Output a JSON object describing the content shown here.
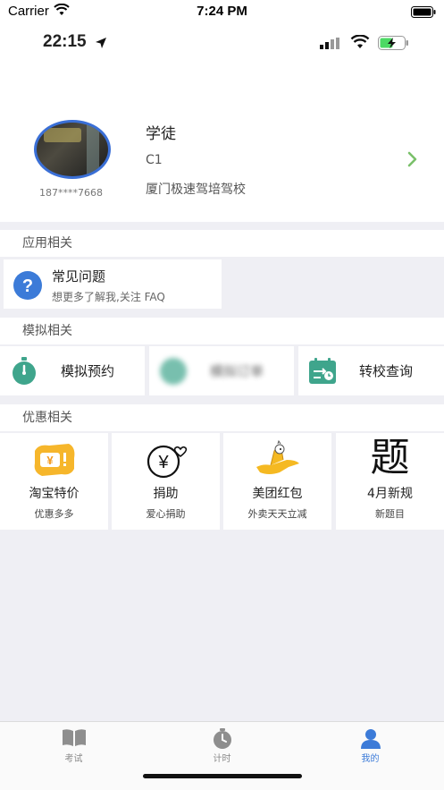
{
  "system_status": {
    "carrier": "Carrier",
    "time": "7:24 PM"
  },
  "embedded_status": {
    "time": "22:15"
  },
  "profile": {
    "phone": "187****7668",
    "name": "学徒",
    "license_type": "C1",
    "school": "厦门极速驾培驾校"
  },
  "sections": {
    "app": {
      "title": "应用相关",
      "items": [
        {
          "title": "常见问题",
          "subtitle": "想更多了解我,关注 FAQ",
          "icon": "question-icon"
        }
      ]
    },
    "simulation": {
      "title": "模拟相关",
      "items": [
        {
          "label": "模拟预约",
          "icon": "stopwatch-icon"
        },
        {
          "label": "模拟订单",
          "icon": "order-icon"
        },
        {
          "label": "转校查询",
          "icon": "calendar-transfer-icon"
        }
      ]
    },
    "discount": {
      "title": "优惠相关",
      "items": [
        {
          "title": "淘宝特价",
          "subtitle": "优惠多多",
          "icon": "taobao-icon"
        },
        {
          "title": "捐助",
          "subtitle": "爱心捐助",
          "icon": "donate-icon"
        },
        {
          "title": "美团红包",
          "subtitle": "外卖天天立减",
          "icon": "meituan-icon"
        },
        {
          "title": "4月新规",
          "subtitle": "新题目",
          "icon_text": "题"
        }
      ]
    }
  },
  "tabbar": {
    "items": [
      {
        "label": "考试",
        "icon": "book-icon",
        "active": false
      },
      {
        "label": "计时",
        "icon": "timer-icon",
        "active": false
      },
      {
        "label": "我的",
        "icon": "person-icon",
        "active": true
      }
    ]
  },
  "colors": {
    "accent": "#3c7bd8",
    "teal": "#3fa58c",
    "background": "#efeff4"
  }
}
